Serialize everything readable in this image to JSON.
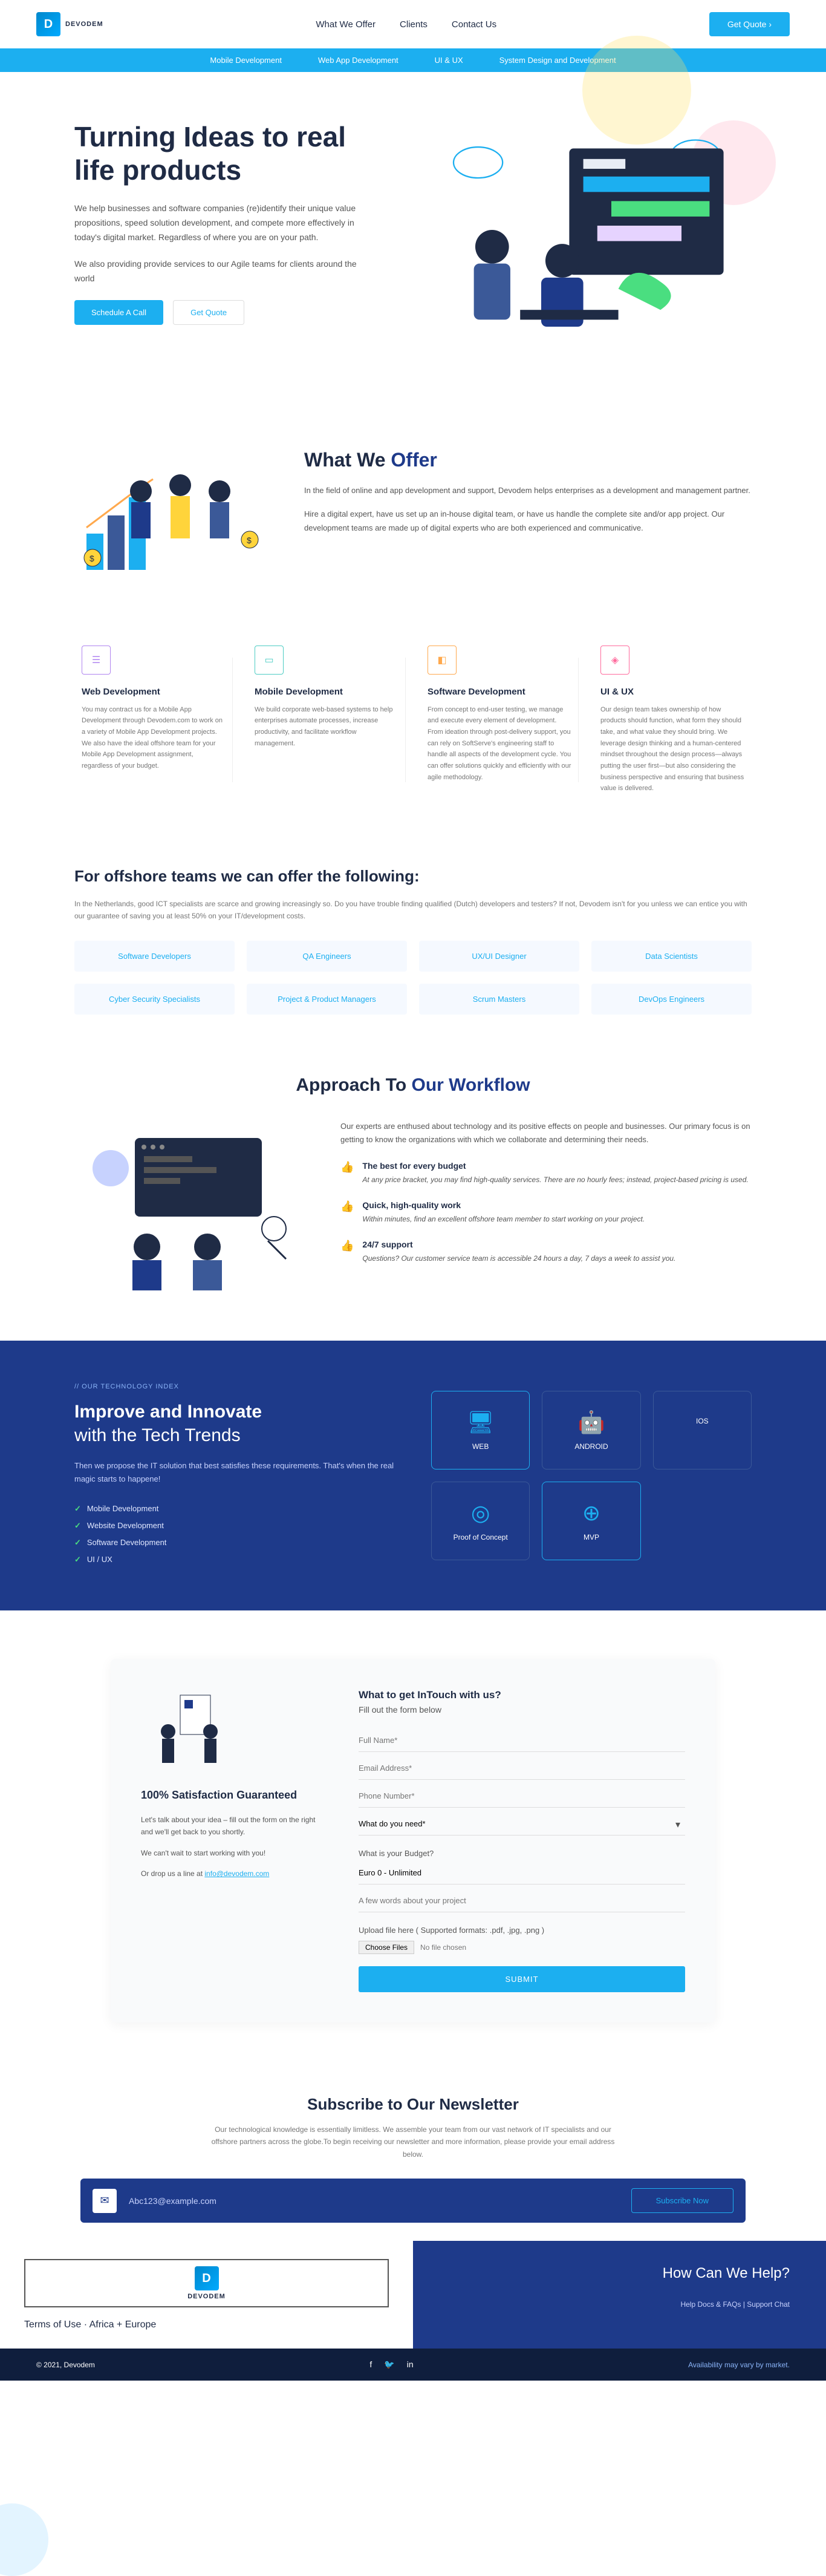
{
  "brand": "DEVODEM",
  "nav": {
    "items": [
      "What We Offer",
      "Clients",
      "Contact Us"
    ],
    "cta": "Get Quote ›"
  },
  "subnav": [
    "Mobile Development",
    "Web App Development",
    "UI & UX",
    "System Design and Development"
  ],
  "hero": {
    "title": "Turning Ideas to real life products",
    "p1": "We help businesses and software companies (re)identify their unique value propositions, speed solution development, and compete more effectively in today's digital market. Regardless of where you are on your path.",
    "p2": "We also providing provide services to our Agile teams for clients around the world",
    "cta1": "Schedule A Call",
    "cta2": "Get Quote"
  },
  "wwo": {
    "heading_a": "What We ",
    "heading_b": "Offer",
    "p1": "In the field of online and app development and support, Devodem helps enterprises as a development and management partner.",
    "p2": "Hire a digital expert, have us set up an in-house digital team, or have us handle the complete site and/or app project. Our development teams are made up of digital experts who are both experienced and communicative."
  },
  "services": [
    {
      "title": "Web Development",
      "desc": "You may contract us for a Mobile App Development through Devodem.com to work on a variety of Mobile App Development projects. We also have the ideal offshore team for your Mobile App Development assignment, regardless of your budget."
    },
    {
      "title": "Mobile Development",
      "desc": "We build corporate web-based systems to help enterprises automate processes, increase productivity, and facilitate workflow management."
    },
    {
      "title": "Software Development",
      "desc": "From concept to end-user testing, we manage and execute every element of development. From ideation through post-delivery support, you can rely on SoftServe's engineering staff to handle all aspects of the development cycle. You can offer solutions quickly and efficiently with our agile methodology."
    },
    {
      "title": "UI & UX",
      "desc": "Our design team takes ownership of how products should function, what form they should take, and what value they should bring. We leverage design thinking and a human-centered mindset throughout the design process—always putting the user first—but also considering the business perspective and ensuring that business value is delivered."
    }
  ],
  "offshore": {
    "title": "For offshore teams we can offer the following:",
    "intro": "In the Netherlands, good ICT specialists are scarce and growing increasingly so. Do you have trouble finding qualified (Dutch) developers and testers? If not, Devodem isn't for you unless we can entice you with our guarantee of saving you at least 50% on your IT/development costs.",
    "roles": [
      "Software Developers",
      "QA Engineers",
      "UX/UI Designer",
      "Data Scientists",
      "Cyber Security Specialists",
      "Project & Product Managers",
      "Scrum Masters",
      "DevOps Engineers"
    ]
  },
  "approach": {
    "heading_a": "Approach To ",
    "heading_b": "Our Workflow",
    "intro": "Our experts are enthused about technology and its positive effects on people and businesses. Our primary focus is on getting to know the organizations with which we collaborate and determining their needs.",
    "items": [
      {
        "title": "The best for every budget",
        "desc": "At any price bracket, you may find high-quality services. There are no hourly fees; instead, project-based pricing is used."
      },
      {
        "title": "Quick, high-quality work",
        "desc": "Within minutes, find an excellent offshore team member to start working on your project."
      },
      {
        "title": "24/7 support",
        "desc": "Questions? Our customer service team is accessible 24 hours a day, 7 days a week to assist you."
      }
    ]
  },
  "tech": {
    "tag": "// OUR TECHNOLOGY INDEX",
    "heading_a": "Improve and Innovate",
    "heading_b": "with the Tech Trends",
    "desc": "Then we propose the IT solution that best satisfies these requirements. That's when the real magic starts to happene!",
    "list": [
      "Mobile Development",
      "Website Development",
      "Software Development",
      "UI / UX"
    ],
    "cards": [
      "WEB",
      "ANDROID",
      "IOS",
      "Proof of Concept",
      "MVP"
    ]
  },
  "contact": {
    "left_title": "100% Satisfaction Guaranteed",
    "left_p1": "Let's talk about your idea – fill out the form on the right and we'll get back to you shortly.",
    "left_p2": "We can't wait to start working with you!",
    "left_p3_a": "Or drop us a line at ",
    "left_p3_b": "info@devodem.com",
    "right_title": "What to get InTouch with us?",
    "right_sub": "Fill out the form below",
    "ph_name": "Full Name*",
    "ph_email": "Email Address*",
    "ph_phone": "Phone Number*",
    "select_need": "What do you need*",
    "label_budget": "What is your Budget?",
    "select_budget": "Euro 0 - Unlimited",
    "ph_about": "A few words about your project",
    "file_label": "Upload file here ( Supported formats: .pdf, .jpg, .png )",
    "file_btn": "Choose Files",
    "file_status": "No file chosen",
    "submit": "SUBMIT"
  },
  "newsletter": {
    "title": "Subscribe to Our Newsletter",
    "desc": "Our technological knowledge is essentially limitless. We assemble your team from our vast network of IT specialists and our offshore partners across the globe.To begin receiving our newsletter and more information, please provide your email address below.",
    "placeholder": "Abc123@example.com",
    "btn": "Subscribe Now"
  },
  "prefooter": {
    "tou": "Terms of Use · Africa + Europe",
    "help": "How Can We Help?",
    "links": "Help Docs & FAQs | Support Chat"
  },
  "footer": {
    "copy": "© 2021, Devodem",
    "avail": "Availability may vary by market."
  }
}
